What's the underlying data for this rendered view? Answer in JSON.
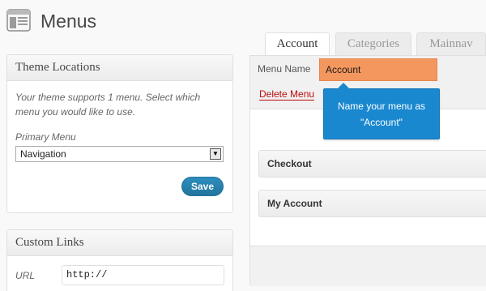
{
  "page": {
    "title": "Menus",
    "icon": "menus-icon"
  },
  "theme_locations": {
    "title": "Theme Locations",
    "hint": "Your theme supports 1 menu. Select which menu you would like to use.",
    "primary_label": "Primary Menu",
    "selected": "Navigation",
    "save_label": "Save"
  },
  "custom_links": {
    "title": "Custom Links",
    "url_label": "URL",
    "url_value": "http://"
  },
  "tabs": [
    {
      "label": "Account",
      "active": true
    },
    {
      "label": "Categories",
      "active": false
    },
    {
      "label": "Mainnav",
      "active": false
    }
  ],
  "menu_editor": {
    "name_label": "Menu Name",
    "name_value": "Account",
    "delete_label": "Delete Menu",
    "tooltip_line1": "Name your menu as",
    "tooltip_line2": "\"Account\"",
    "items": [
      {
        "label": "Checkout"
      },
      {
        "label": "My Account"
      }
    ]
  },
  "colors": {
    "highlight": "#f4975e",
    "tooltip": "#1a88cf",
    "save_button": "#21759b",
    "delete_link": "#bc0b0b"
  }
}
